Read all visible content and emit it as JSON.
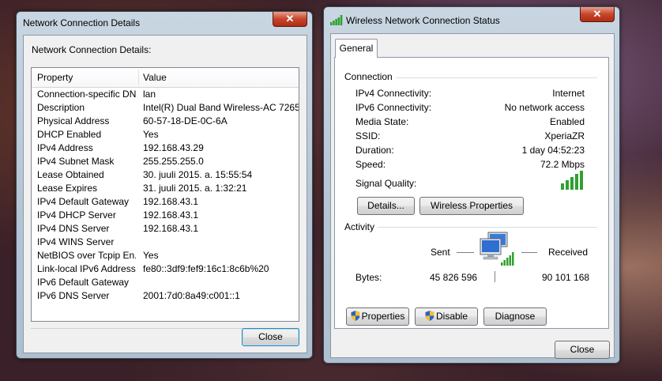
{
  "details_window": {
    "title": "Network Connection Details",
    "close_glyph": "✕",
    "group_label": "Network Connection Details:",
    "columns": {
      "property": "Property",
      "value": "Value"
    },
    "rows": [
      {
        "property": "Connection-specific DN...",
        "value": "lan"
      },
      {
        "property": "Description",
        "value": "Intel(R) Dual Band Wireless-AC 7265"
      },
      {
        "property": "Physical Address",
        "value": "60-57-18-DE-0C-6A"
      },
      {
        "property": "DHCP Enabled",
        "value": "Yes"
      },
      {
        "property": "IPv4 Address",
        "value": "192.168.43.29"
      },
      {
        "property": "IPv4 Subnet Mask",
        "value": "255.255.255.0"
      },
      {
        "property": "Lease Obtained",
        "value": "30. juuli 2015. a. 15:55:54"
      },
      {
        "property": "Lease Expires",
        "value": "31. juuli 2015. a. 1:32:21"
      },
      {
        "property": "IPv4 Default Gateway",
        "value": "192.168.43.1"
      },
      {
        "property": "IPv4 DHCP Server",
        "value": "192.168.43.1"
      },
      {
        "property": "IPv4 DNS Server",
        "value": "192.168.43.1"
      },
      {
        "property": "IPv4 WINS Server",
        "value": ""
      },
      {
        "property": "NetBIOS over Tcpip En...",
        "value": "Yes"
      },
      {
        "property": "Link-local IPv6 Address",
        "value": "fe80::3df9:fef9:16c1:8c6b%20"
      },
      {
        "property": "IPv6 Default Gateway",
        "value": ""
      },
      {
        "property": "IPv6 DNS Server",
        "value": "2001:7d0:8a49:c001::1"
      }
    ],
    "close_button": "Close"
  },
  "status_window": {
    "title": "Wireless Network Connection Status",
    "close_glyph": "✕",
    "tab": "General",
    "connection": {
      "label": "Connection",
      "items": [
        {
          "key": "IPv4 Connectivity:",
          "value": "Internet"
        },
        {
          "key": "IPv6 Connectivity:",
          "value": "No network access"
        },
        {
          "key": "Media State:",
          "value": "Enabled"
        },
        {
          "key": "SSID:",
          "value": "XperiaZR"
        },
        {
          "key": "Duration:",
          "value": "1 day 04:52:23"
        },
        {
          "key": "Speed:",
          "value": "72.2 Mbps"
        }
      ],
      "signal_label": "Signal Quality:",
      "signal_bars": 5,
      "details_button": "Details...",
      "wireless_properties_button": "Wireless Properties"
    },
    "activity": {
      "label": "Activity",
      "sent_label": "Sent",
      "received_label": "Received",
      "bytes_label": "Bytes:",
      "bytes_sent": "45 826 596",
      "bytes_received": "90 101 168",
      "properties_button": "Properties",
      "disable_button": "Disable",
      "diagnose_button": "Diagnose"
    },
    "close_button": "Close"
  },
  "colors": {
    "signal_green": "#2fa12f",
    "close_red": "#c7452c"
  }
}
